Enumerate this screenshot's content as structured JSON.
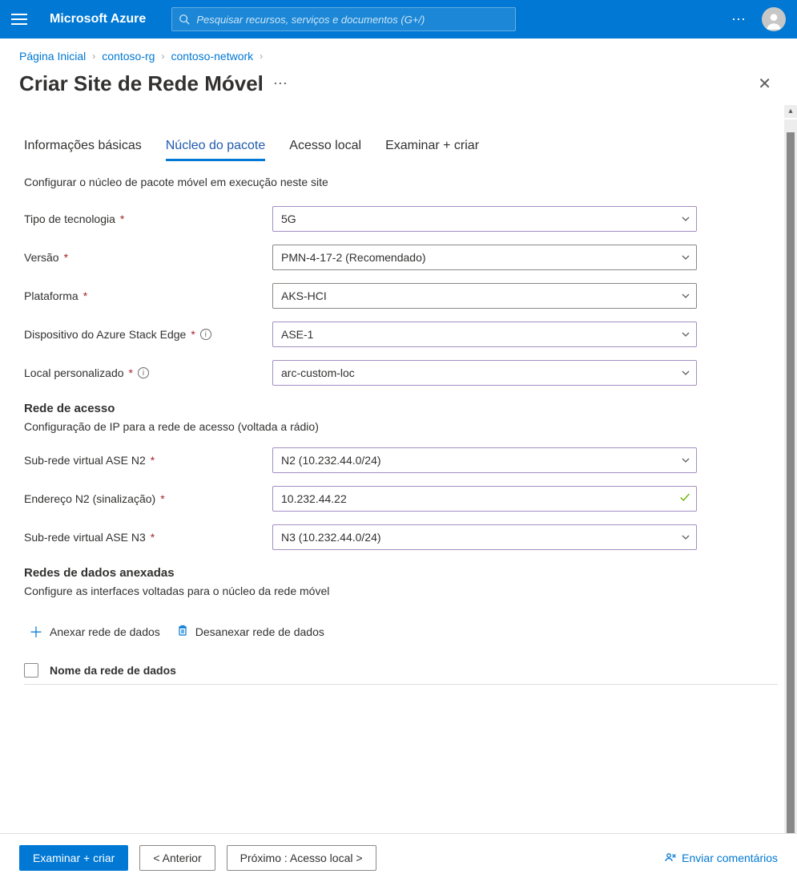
{
  "topbar": {
    "brand": "Microsoft Azure",
    "search_placeholder": "Pesquisar recursos, serviços e documentos (G+/)"
  },
  "breadcrumb": {
    "home": "Página Inicial",
    "rg": "contoso-rg",
    "net": "contoso-network"
  },
  "title": "Criar Site de Rede Móvel",
  "tabs": {
    "basics": "Informações básicas",
    "core": "Núcleo do pacote",
    "local": "Acesso local",
    "review": "Examinar + criar"
  },
  "section_desc": "Configurar o núcleo de pacote móvel em execução neste site",
  "fields": {
    "tech_label": "Tipo de tecnologia",
    "tech_value": "5G",
    "version_label": "Versão",
    "version_value": "PMN-4-17-2 (Recomendado)",
    "platform_label": "Plataforma",
    "platform_value": "AKS-HCI",
    "ase_label": "Dispositivo do Azure Stack Edge",
    "ase_value": "ASE-1",
    "custloc_label": "Local personalizado",
    "custloc_value": "arc-custom-loc"
  },
  "access": {
    "title": "Rede de acesso",
    "desc": "Configuração de IP para a rede de acesso (voltada a rádio)",
    "n2_subnet_label": "Sub-rede virtual ASE N2",
    "n2_subnet_value": "N2 (10.232.44.0/24)",
    "n2_addr_label": "Endereço N2 (sinalização)",
    "n2_addr_value": "10.232.44.22",
    "n3_subnet_label": "Sub-rede virtual ASE N3",
    "n3_subnet_value": "N3 (10.232.44.0/24)"
  },
  "datanet": {
    "title": "Redes de dados anexadas",
    "desc": "Configure as interfaces voltadas para o núcleo da rede móvel",
    "attach": "Anexar rede de dados",
    "detach": "Desanexar rede de dados",
    "col_name": "Nome da rede de dados"
  },
  "footer": {
    "review": "Examinar + criar",
    "prev": "< Anterior",
    "next": "Próximo :  Acesso local >",
    "feedback": "Enviar comentários"
  }
}
